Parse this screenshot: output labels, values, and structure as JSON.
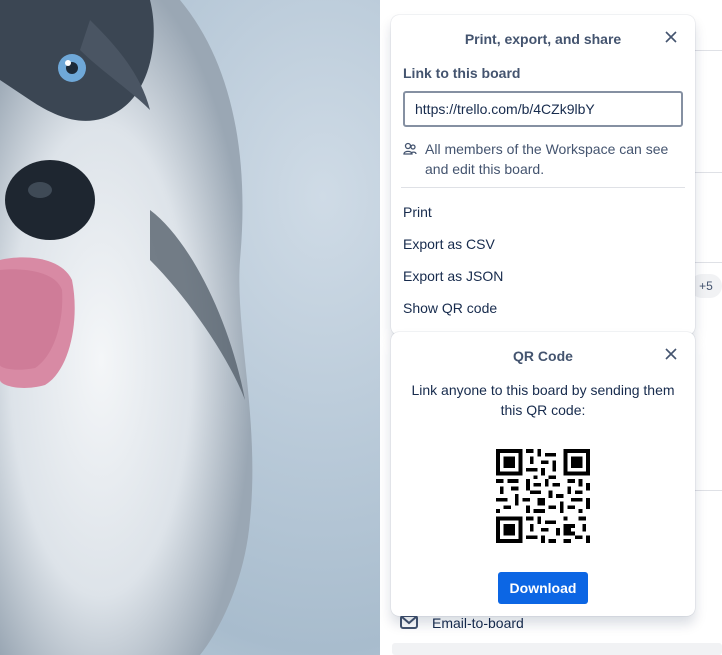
{
  "share_popover": {
    "title": "Print, export, and share",
    "link_label": "Link to this board",
    "link_value": "https://trello.com/b/4CZk9lbY",
    "permission_note": "All members of the Workspace can see and edit this board.",
    "menu": [
      "Print",
      "Export as CSV",
      "Export as JSON",
      "Show QR code"
    ]
  },
  "qr_popover": {
    "title": "QR Code",
    "description": "Link anyone to this board by sending them this QR code:",
    "download_label": "Download"
  },
  "sidebar": {
    "members_badge": "+5",
    "email_to_board": "Email-to-board"
  },
  "colors": {
    "accent": "#0c66e4",
    "text": "#172b4d",
    "subtle": "#44546f"
  },
  "icons": {
    "close": "close-icon",
    "people": "people-icon",
    "mail": "mail-icon"
  }
}
